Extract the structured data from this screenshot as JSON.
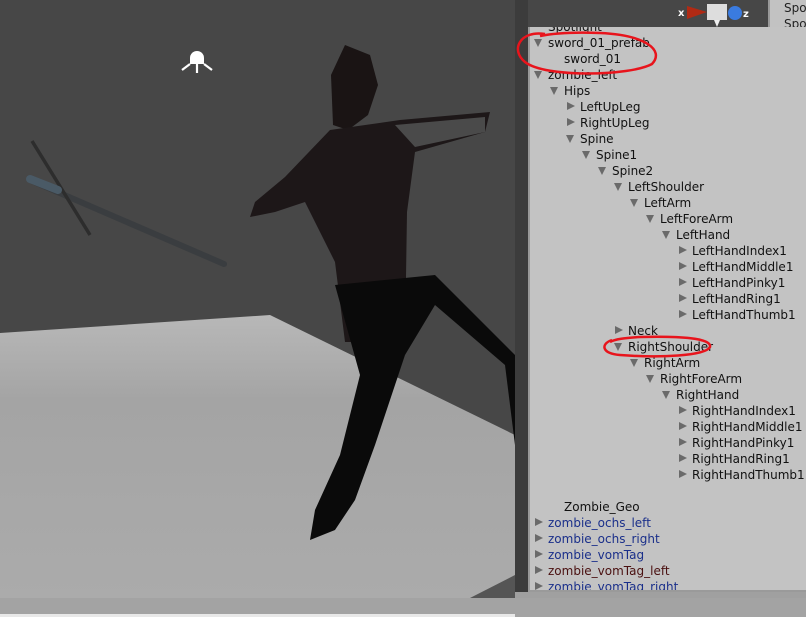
{
  "gizmo": {
    "x_label": "x",
    "z_label": "z"
  },
  "inspector": {
    "lines": [
      "Spo",
      "Spo"
    ]
  },
  "hierarchy": {
    "items": [
      {
        "label": "Spotlight",
        "level": 0,
        "arrow": "none",
        "color": "#111111"
      },
      {
        "label": "sword_01_prefab",
        "level": 0,
        "arrow": "open",
        "color": "#111111"
      },
      {
        "label": "sword_01",
        "level": 1,
        "arrow": "none",
        "color": "#111111"
      },
      {
        "label": "zombie_left",
        "level": 0,
        "arrow": "open",
        "color": "#111111"
      },
      {
        "label": "Hips",
        "level": 1,
        "arrow": "open",
        "color": "#111111"
      },
      {
        "label": "LeftUpLeg",
        "level": 2,
        "arrow": "closed",
        "color": "#111111"
      },
      {
        "label": "RightUpLeg",
        "level": 2,
        "arrow": "closed",
        "color": "#111111"
      },
      {
        "label": "Spine",
        "level": 2,
        "arrow": "open",
        "color": "#111111"
      },
      {
        "label": "Spine1",
        "level": 3,
        "arrow": "open",
        "color": "#111111"
      },
      {
        "label": "Spine2",
        "level": 4,
        "arrow": "open",
        "color": "#111111"
      },
      {
        "label": "LeftShoulder",
        "level": 5,
        "arrow": "open",
        "color": "#111111"
      },
      {
        "label": "LeftArm",
        "level": 6,
        "arrow": "open",
        "color": "#111111"
      },
      {
        "label": "LeftForeArm",
        "level": 7,
        "arrow": "open",
        "color": "#111111"
      },
      {
        "label": "LeftHand",
        "level": 8,
        "arrow": "open",
        "color": "#111111"
      },
      {
        "label": "LeftHandIndex1",
        "level": 9,
        "arrow": "closed",
        "color": "#111111"
      },
      {
        "label": "LeftHandMiddle1",
        "level": 9,
        "arrow": "closed",
        "color": "#111111"
      },
      {
        "label": "LeftHandPinky1",
        "level": 9,
        "arrow": "closed",
        "color": "#111111"
      },
      {
        "label": "LeftHandRing1",
        "level": 9,
        "arrow": "closed",
        "color": "#111111"
      },
      {
        "label": "LeftHandThumb1",
        "level": 9,
        "arrow": "closed",
        "color": "#111111"
      },
      {
        "label": "Neck",
        "level": 5,
        "arrow": "closed",
        "color": "#111111"
      },
      {
        "label": "RightShoulder",
        "level": 5,
        "arrow": "open",
        "color": "#111111"
      },
      {
        "label": "RightArm",
        "level": 6,
        "arrow": "open",
        "color": "#111111"
      },
      {
        "label": "RightForeArm",
        "level": 7,
        "arrow": "open",
        "color": "#111111"
      },
      {
        "label": "RightHand",
        "level": 8,
        "arrow": "open",
        "color": "#111111"
      },
      {
        "label": "RightHandIndex1",
        "level": 9,
        "arrow": "closed",
        "color": "#111111"
      },
      {
        "label": "RightHandMiddle1",
        "level": 9,
        "arrow": "closed",
        "color": "#111111"
      },
      {
        "label": "RightHandPinky1",
        "level": 9,
        "arrow": "closed",
        "color": "#111111"
      },
      {
        "label": "RightHandRing1",
        "level": 9,
        "arrow": "closed",
        "color": "#111111"
      },
      {
        "label": "RightHandThumb1",
        "level": 9,
        "arrow": "closed",
        "color": "#111111"
      },
      {
        "label": "",
        "level": 0,
        "arrow": "none",
        "color": "#111111"
      },
      {
        "label": "Zombie_Geo",
        "level": 1,
        "arrow": "none",
        "color": "#111111"
      },
      {
        "label": "zombie_ochs_left",
        "level": 0,
        "arrow": "closed",
        "color": "#1a2f8a"
      },
      {
        "label": "zombie_ochs_right",
        "level": 0,
        "arrow": "closed",
        "color": "#1a2f8a"
      },
      {
        "label": "zombie_vomTag",
        "level": 0,
        "arrow": "closed",
        "color": "#1a2f8a"
      },
      {
        "label": "zombie_vomTag_left",
        "level": 0,
        "arrow": "closed",
        "color": "#4a1010"
      },
      {
        "label": "zombie_vomTag_right",
        "level": 0,
        "arrow": "closed",
        "color": "#1a2f8a"
      }
    ]
  },
  "annotation_color": "#e8141c"
}
